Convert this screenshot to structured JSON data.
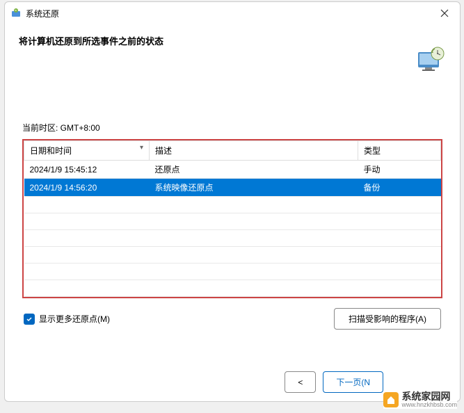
{
  "titlebar": {
    "title": "系统还原"
  },
  "header": {
    "title": "将计算机还原到所选事件之前的状态"
  },
  "timezone_label": "当前时区: GMT+8:00",
  "table": {
    "headers": {
      "date": "日期和时间",
      "desc": "描述",
      "type": "类型"
    },
    "rows": [
      {
        "date": "2024/1/9 15:45:12",
        "desc": "还原点",
        "type": "手动",
        "selected": false
      },
      {
        "date": "2024/1/9 14:56:20",
        "desc": "系统映像还原点",
        "type": "备份",
        "selected": true
      }
    ]
  },
  "checkbox": {
    "label": "显示更多还原点(M)"
  },
  "buttons": {
    "scan": "扫描受影响的程序(A)",
    "back": "<  ",
    "next": "下一页(N"
  },
  "watermark": {
    "name": "系统家园网",
    "url": "www.hnzkhbsb.com"
  }
}
